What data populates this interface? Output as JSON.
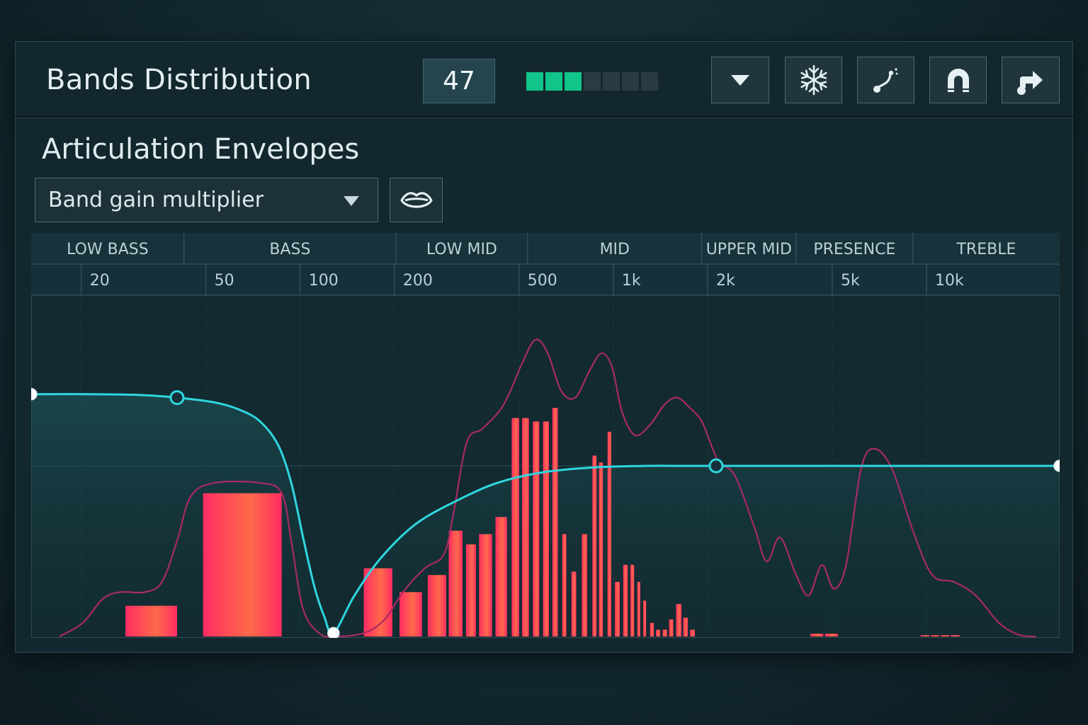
{
  "header": {
    "title": "Bands Distribution",
    "count": "47",
    "meter": {
      "active": 3,
      "total": 7
    },
    "buttons": [
      {
        "icon": "chevron-down-icon"
      },
      {
        "icon": "snowflake-icon"
      },
      {
        "icon": "curve-tool-icon"
      },
      {
        "icon": "magnet-icon"
      },
      {
        "icon": "export-arrow-icon"
      }
    ]
  },
  "section": {
    "title": "Articulation Envelopes",
    "dropdown_value": "Band gain multiplier",
    "lips_icon": "lips-icon"
  },
  "colors": {
    "accent": "#10c48a",
    "curve": "#2fd6e0",
    "spectrum_line": "#a82a66",
    "bar_low": "#ff2d63",
    "bar_high": "#ff6a4a"
  },
  "chart_data": {
    "type": "bar",
    "x_scale": "log",
    "xlim": [
      13,
      25000
    ],
    "band_labels": [
      {
        "label": "LOW BASS",
        "range": [
          13,
          40
        ]
      },
      {
        "label": "BASS",
        "range": [
          40,
          190
        ]
      },
      {
        "label": "LOW MID",
        "range": [
          190,
          500
        ]
      },
      {
        "label": "MID",
        "range": [
          500,
          1800
        ]
      },
      {
        "label": "UPPER MID",
        "range": [
          1800,
          3600
        ]
      },
      {
        "label": "PRESENCE",
        "range": [
          3600,
          8500
        ]
      },
      {
        "label": "TREBLE",
        "range": [
          8500,
          25000
        ]
      }
    ],
    "frequency_ticks": [
      {
        "label": "20",
        "value": 20
      },
      {
        "label": "50",
        "value": 50
      },
      {
        "label": "100",
        "value": 100
      },
      {
        "label": "200",
        "value": 200
      },
      {
        "label": "500",
        "value": 500
      },
      {
        "label": "1k",
        "value": 1000
      },
      {
        "label": "2k",
        "value": 2000
      },
      {
        "label": "5k",
        "value": 5000
      },
      {
        "label": "10k",
        "value": 10000
      }
    ],
    "bars": [
      {
        "f0": 26,
        "f1": 38,
        "value": 0.09
      },
      {
        "f0": 46,
        "f1": 82,
        "value": 0.42
      },
      {
        "f0": 150,
        "f1": 185,
        "value": 0.2
      },
      {
        "f0": 195,
        "f1": 230,
        "value": 0.13
      },
      {
        "f0": 240,
        "f1": 275,
        "value": 0.18
      },
      {
        "f0": 280,
        "f1": 310,
        "value": 0.31
      },
      {
        "f0": 318,
        "f1": 342,
        "value": 0.27
      },
      {
        "f0": 350,
        "f1": 385,
        "value": 0.3
      },
      {
        "f0": 395,
        "f1": 430,
        "value": 0.35
      },
      {
        "f0": 445,
        "f1": 470,
        "value": 0.64
      },
      {
        "f0": 480,
        "f1": 505,
        "value": 0.64
      },
      {
        "f0": 520,
        "f1": 545,
        "value": 0.63
      },
      {
        "f0": 560,
        "f1": 585,
        "value": 0.63
      },
      {
        "f0": 600,
        "f1": 625,
        "value": 0.67
      },
      {
        "f0": 645,
        "f1": 665,
        "value": 0.3
      },
      {
        "f0": 690,
        "f1": 715,
        "value": 0.19
      },
      {
        "f0": 745,
        "f1": 775,
        "value": 0.3
      },
      {
        "f0": 805,
        "f1": 830,
        "value": 0.53
      },
      {
        "f0": 845,
        "f1": 870,
        "value": 0.51
      },
      {
        "f0": 900,
        "f1": 925,
        "value": 0.6
      },
      {
        "f0": 950,
        "f1": 985,
        "value": 0.16
      },
      {
        "f0": 1010,
        "f1": 1045,
        "value": 0.21
      },
      {
        "f0": 1065,
        "f1": 1095,
        "value": 0.21
      },
      {
        "f0": 1120,
        "f1": 1145,
        "value": 0.16
      },
      {
        "f0": 1170,
        "f1": 1195,
        "value": 0.105
      },
      {
        "f0": 1230,
        "f1": 1265,
        "value": 0.04
      },
      {
        "f0": 1285,
        "f1": 1325,
        "value": 0.02
      },
      {
        "f0": 1350,
        "f1": 1395,
        "value": 0.02
      },
      {
        "f0": 1415,
        "f1": 1460,
        "value": 0.05
      },
      {
        "f0": 1490,
        "f1": 1550,
        "value": 0.095
      },
      {
        "f0": 1570,
        "f1": 1625,
        "value": 0.055
      },
      {
        "f0": 1650,
        "f1": 1710,
        "value": 0.02
      },
      {
        "f0": 4000,
        "f1": 4400,
        "value": 0.008
      },
      {
        "f0": 4450,
        "f1": 4900,
        "value": 0.008
      },
      {
        "f0": 9000,
        "f1": 9600,
        "value": 0.004
      },
      {
        "f0": 9700,
        "f1": 10300,
        "value": 0.004
      },
      {
        "f0": 10400,
        "f1": 11100,
        "value": 0.004
      },
      {
        "f0": 11200,
        "f1": 12000,
        "value": 0.004
      }
    ],
    "spectrum_line": [
      [
        16,
        0.0
      ],
      [
        19,
        0.04
      ],
      [
        22,
        0.11
      ],
      [
        25,
        0.13
      ],
      [
        30,
        0.13
      ],
      [
        34,
        0.16
      ],
      [
        38,
        0.28
      ],
      [
        42,
        0.41
      ],
      [
        50,
        0.45
      ],
      [
        70,
        0.45
      ],
      [
        82,
        0.42
      ],
      [
        88,
        0.28
      ],
      [
        96,
        0.08
      ],
      [
        108,
        0.01
      ],
      [
        120,
        0.0
      ],
      [
        150,
        0.01
      ],
      [
        175,
        0.05
      ],
      [
        200,
        0.13
      ],
      [
        235,
        0.2
      ],
      [
        270,
        0.24
      ],
      [
        290,
        0.36
      ],
      [
        320,
        0.57
      ],
      [
        360,
        0.61
      ],
      [
        420,
        0.68
      ],
      [
        480,
        0.8
      ],
      [
        530,
        0.87
      ],
      [
        580,
        0.83
      ],
      [
        640,
        0.72
      ],
      [
        710,
        0.7
      ],
      [
        790,
        0.78
      ],
      [
        860,
        0.83
      ],
      [
        930,
        0.79
      ],
      [
        1000,
        0.66
      ],
      [
        1100,
        0.59
      ],
      [
        1230,
        0.62
      ],
      [
        1370,
        0.68
      ],
      [
        1500,
        0.7
      ],
      [
        1650,
        0.67
      ],
      [
        1800,
        0.63
      ],
      [
        1950,
        0.55
      ],
      [
        2050,
        0.51
      ],
      [
        2300,
        0.47
      ],
      [
        2650,
        0.32
      ],
      [
        2900,
        0.22
      ],
      [
        3200,
        0.29
      ],
      [
        3600,
        0.18
      ],
      [
        3950,
        0.12
      ],
      [
        4350,
        0.21
      ],
      [
        4750,
        0.14
      ],
      [
        5200,
        0.21
      ],
      [
        5800,
        0.49
      ],
      [
        6400,
        0.55
      ],
      [
        7300,
        0.49
      ],
      [
        8500,
        0.31
      ],
      [
        9800,
        0.18
      ],
      [
        11500,
        0.16
      ],
      [
        13500,
        0.12
      ],
      [
        16000,
        0.04
      ],
      [
        18500,
        0.005
      ],
      [
        21000,
        0.0
      ]
    ],
    "envelope_points": [
      {
        "f": 13,
        "value": 0.71
      },
      {
        "f": 38,
        "value": 0.7
      },
      {
        "f": 120,
        "value": 0.01
      },
      {
        "f": 2000,
        "value": 0.5
      },
      {
        "f": 25000,
        "value": 0.5
      }
    ],
    "envelope_curve": [
      [
        13,
        0.71
      ],
      [
        20,
        0.71
      ],
      [
        30,
        0.707
      ],
      [
        38,
        0.7
      ],
      [
        50,
        0.686
      ],
      [
        60,
        0.665
      ],
      [
        70,
        0.63
      ],
      [
        80,
        0.56
      ],
      [
        88,
        0.45
      ],
      [
        96,
        0.29
      ],
      [
        104,
        0.15
      ],
      [
        112,
        0.06
      ],
      [
        120,
        0.01
      ],
      [
        140,
        0.12
      ],
      [
        170,
        0.23
      ],
      [
        220,
        0.33
      ],
      [
        300,
        0.4
      ],
      [
        400,
        0.45
      ],
      [
        550,
        0.48
      ],
      [
        800,
        0.495
      ],
      [
        1200,
        0.5
      ],
      [
        2000,
        0.5
      ],
      [
        25000,
        0.5
      ]
    ],
    "ylim": [
      0,
      1
    ],
    "grid": true
  }
}
